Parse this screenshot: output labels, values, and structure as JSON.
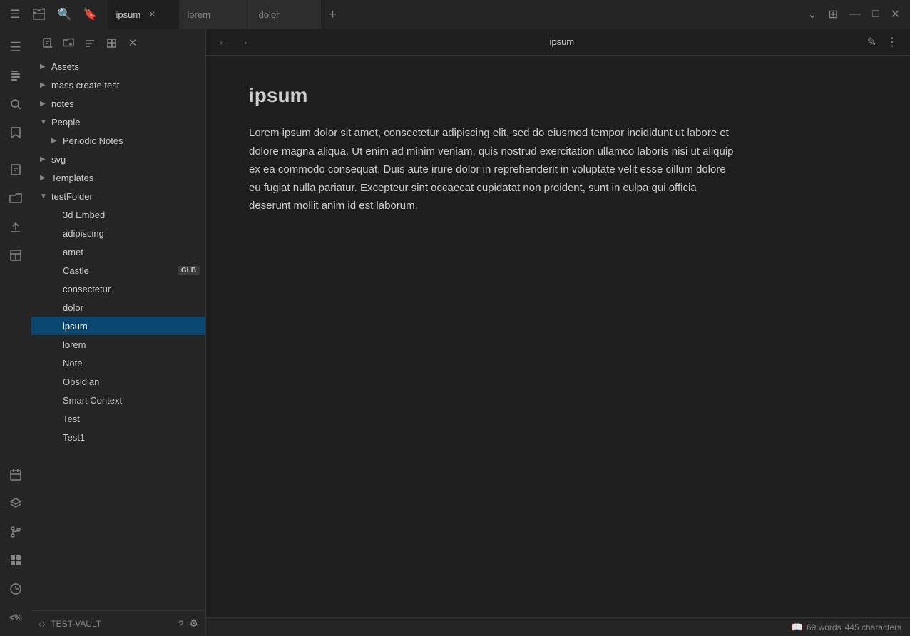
{
  "titleBar": {
    "tabs": [
      {
        "id": "ipsum",
        "label": "ipsum",
        "active": true,
        "closeable": true
      },
      {
        "id": "lorem",
        "label": "lorem",
        "active": false,
        "closeable": false
      },
      {
        "id": "dolor",
        "label": "dolor",
        "active": false,
        "closeable": false
      }
    ],
    "addTabLabel": "+",
    "windowControls": {
      "minimize": "—",
      "maximize": "□",
      "close": "✕"
    }
  },
  "activityBar": {
    "icons": [
      {
        "id": "sidebar-toggle",
        "symbol": "☰",
        "active": false
      },
      {
        "id": "files",
        "symbol": "📁",
        "active": false
      },
      {
        "id": "search",
        "symbol": "🔍",
        "active": false
      },
      {
        "id": "bookmark",
        "symbol": "🔖",
        "active": false
      },
      {
        "id": "new-note",
        "symbol": "📝",
        "active": false
      },
      {
        "id": "folder-open",
        "symbol": "📂",
        "active": false
      },
      {
        "id": "upload",
        "symbol": "⬆",
        "active": false
      },
      {
        "id": "layout",
        "symbol": "⊞",
        "active": false
      },
      {
        "id": "calendar",
        "symbol": "📅",
        "active": false
      },
      {
        "id": "layers",
        "symbol": "⧉",
        "active": false
      },
      {
        "id": "git",
        "symbol": "⎇",
        "active": false
      },
      {
        "id": "apps",
        "symbol": "⊞",
        "active": false
      },
      {
        "id": "clock",
        "symbol": "◷",
        "active": false
      },
      {
        "id": "percent",
        "symbol": "<%",
        "active": false
      }
    ]
  },
  "sidebar": {
    "toolbar": {
      "buttons": [
        {
          "id": "new-note-btn",
          "symbol": "📝"
        },
        {
          "id": "new-folder-btn",
          "symbol": "📁"
        },
        {
          "id": "sort-btn",
          "symbol": "↕"
        },
        {
          "id": "collapse-btn",
          "symbol": "⊟"
        },
        {
          "id": "close-btn",
          "symbol": "✕"
        }
      ]
    },
    "tree": [
      {
        "id": "assets",
        "label": "Assets",
        "indent": 0,
        "hasArrow": true,
        "arrowDir": "right"
      },
      {
        "id": "mass-create-test",
        "label": "mass create test",
        "indent": 0,
        "hasArrow": true,
        "arrowDir": "right"
      },
      {
        "id": "notes",
        "label": "notes",
        "indent": 0,
        "hasArrow": true,
        "arrowDir": "right"
      },
      {
        "id": "people",
        "label": "People",
        "indent": 0,
        "hasArrow": true,
        "arrowDir": "down",
        "expanded": true
      },
      {
        "id": "periodic-notes",
        "label": "Periodic Notes",
        "indent": 1,
        "hasArrow": true,
        "arrowDir": "right"
      },
      {
        "id": "svg",
        "label": "svg",
        "indent": 0,
        "hasArrow": true,
        "arrowDir": "right"
      },
      {
        "id": "templates",
        "label": "Templates",
        "indent": 0,
        "hasArrow": true,
        "arrowDir": "right"
      },
      {
        "id": "testfolder",
        "label": "testFolder",
        "indent": 0,
        "hasArrow": true,
        "arrowDir": "down",
        "expanded": true
      },
      {
        "id": "3d-embed",
        "label": "3d Embed",
        "indent": 1,
        "hasArrow": false
      },
      {
        "id": "adipiscing",
        "label": "adipiscing",
        "indent": 1,
        "hasArrow": false
      },
      {
        "id": "amet",
        "label": "amet",
        "indent": 1,
        "hasArrow": false
      },
      {
        "id": "castle",
        "label": "Castle",
        "indent": 1,
        "hasArrow": false,
        "badge": "GLB"
      },
      {
        "id": "consectetur",
        "label": "consectetur",
        "indent": 1,
        "hasArrow": false
      },
      {
        "id": "dolor",
        "label": "dolor",
        "indent": 1,
        "hasArrow": false
      },
      {
        "id": "ipsum",
        "label": "ipsum",
        "indent": 1,
        "hasArrow": false,
        "active": true
      },
      {
        "id": "lorem",
        "label": "lorem",
        "indent": 1,
        "hasArrow": false
      },
      {
        "id": "note",
        "label": "Note",
        "indent": 1,
        "hasArrow": false
      },
      {
        "id": "obsidian",
        "label": "Obsidian",
        "indent": 1,
        "hasArrow": false
      },
      {
        "id": "smart-context",
        "label": "Smart Context",
        "indent": 1,
        "hasArrow": false
      },
      {
        "id": "test",
        "label": "Test",
        "indent": 1,
        "hasArrow": false
      },
      {
        "id": "test1",
        "label": "Test1",
        "indent": 1,
        "hasArrow": false
      }
    ],
    "footer": {
      "vaultName": "TEST-VAULT",
      "helpSymbol": "?",
      "settingsSymbol": "⚙"
    }
  },
  "editor": {
    "title": "ipsum",
    "docTitle": "ipsum",
    "body": "Lorem ipsum dolor sit amet, consectetur adipiscing elit, sed do eiusmod tempor incididunt ut labore et dolore magna aliqua. Ut enim ad minim veniam, quis nostrud exercitation ullamco laboris nisi ut aliquip ex ea commodo consequat. Duis aute irure dolor in reprehenderit in voluptate velit esse cillum dolore eu fugiat nulla pariatur. Excepteur sint occaecat cupidatat non proident, sunt in culpa qui officia deserunt mollit anim id est laborum.",
    "statusbar": {
      "wordCount": "69 words",
      "charCount": "445 characters",
      "bookIcon": "📖"
    }
  }
}
